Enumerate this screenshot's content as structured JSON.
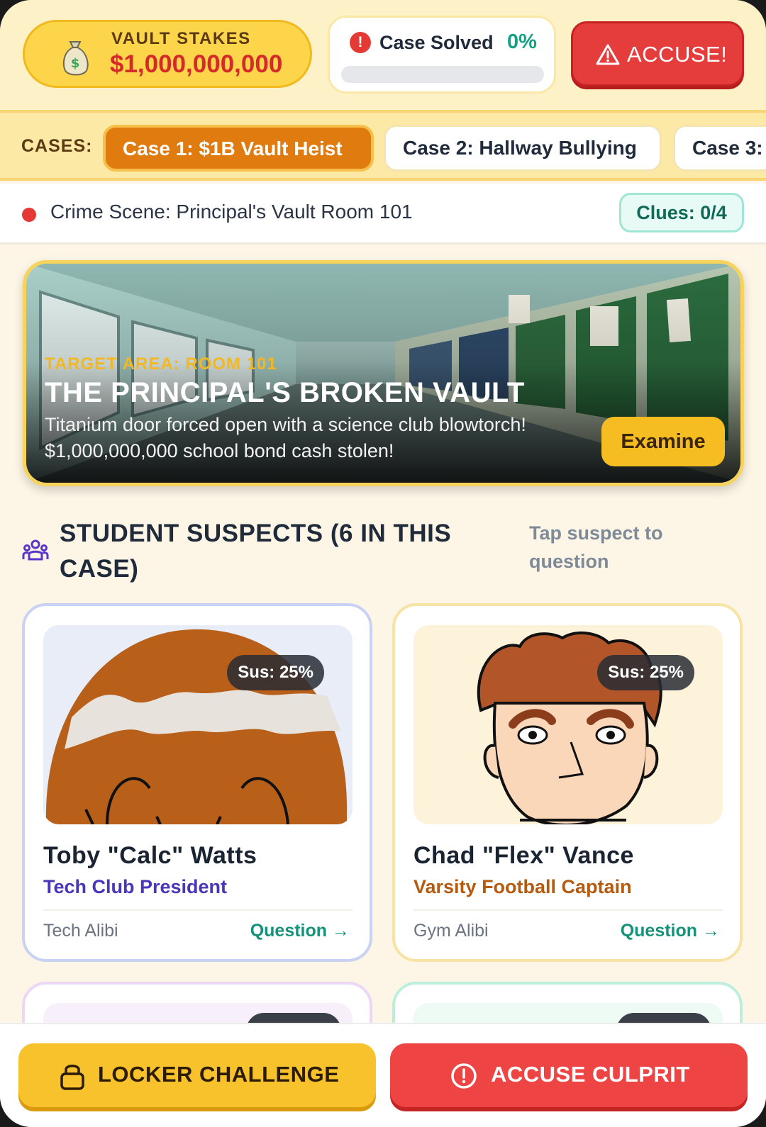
{
  "header": {
    "stakes_label": "VAULT STAKES",
    "stakes_value": "$1,000,000,000",
    "solved_label": "Case Solved",
    "solved_percent": "0%",
    "solved_progress": 0,
    "accuse_label": "ACCUSE!",
    "icons": {
      "stakes": "money-bag-icon",
      "solved": "alert-circle-icon",
      "accuse": "warning-triangle-icon"
    }
  },
  "cases": {
    "label": "CASES:",
    "tabs": [
      {
        "label": "Case 1: $1B Vault Heist",
        "active": true
      },
      {
        "label": "Case 2: Hallway Bullying",
        "active": false
      },
      {
        "label": "Case 3:",
        "active": false
      }
    ]
  },
  "scene": {
    "label": "Crime Scene: Principal's Vault Room 101",
    "clues": "Clues: 0/4"
  },
  "hero": {
    "target": "TARGET AREA: ROOM 101",
    "title": "THE PRINCIPAL'S BROKEN VAULT",
    "desc_line1": "Titanium door forced open with a science club blowtorch!",
    "desc_line2": "$1,000,000,000 school bond cash stolen!",
    "examine_label": "Examine"
  },
  "suspects": {
    "title": "STUDENT SUSPECTS (6 IN THIS CASE)",
    "hint": "Tap suspect to question",
    "cards": [
      {
        "name": "Toby \"Calc\" Watts",
        "role": "Tech Club President",
        "alibi": "Tech Alibi",
        "sus": "Sus: 25%",
        "action": "Question →"
      },
      {
        "name": "Chad \"Flex\" Vance",
        "role": "Varsity Football Captain",
        "alibi": "Gym Alibi",
        "sus": "Sus: 25%",
        "action": "Question →"
      }
    ]
  },
  "bottom": {
    "locker_label": "LOCKER CHALLENGE",
    "accuse_label": "ACCUSE CULPRIT",
    "icons": {
      "locker": "lock-icon",
      "accuse": "alert-circle-icon"
    }
  },
  "colors": {
    "accent_yellow": "#f7c22b",
    "accent_red": "#ef4444",
    "accent_teal": "#14937a",
    "active_tab": "#e07b10"
  }
}
